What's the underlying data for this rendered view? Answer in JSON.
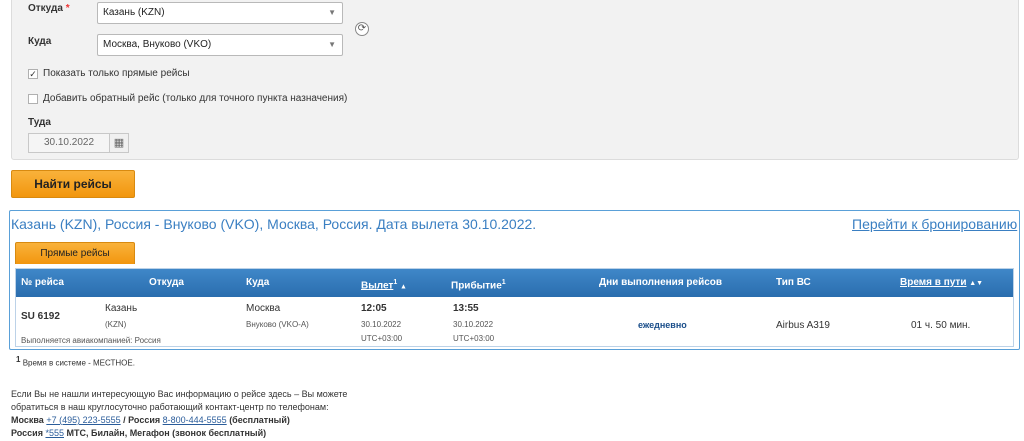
{
  "form": {
    "from_label": "Откуда",
    "required_mark": "*",
    "from_value": "Казань (KZN)",
    "to_label": "Куда",
    "to_value": "Москва, Внуково (VKO)",
    "direct_only_label": "Показать только прямые рейсы",
    "direct_only_checked": true,
    "return_label": "Добавить обратный рейс (только для точного пункта назначения)",
    "return_checked": false,
    "date_label": "Туда",
    "date_value": "30.10.2022",
    "search_button": "Найти рейсы"
  },
  "results": {
    "title": "Казань (KZN), Россия - Внуково (VKO), Москва, Россия. Дата вылета 30.10.2022.",
    "booking_link": "Перейти к бронированию",
    "tab_label": "Прямые рейсы",
    "columns": {
      "flight": "№ рейса",
      "from": "Откуда",
      "to": "Куда",
      "departure": "Вылет",
      "departure_sup": "1",
      "departure_sort": "▲",
      "arrival": "Прибытие",
      "arrival_sup": "1",
      "days": "Дни выполнения рейсов",
      "aircraft": "Тип ВС",
      "duration": "Время в пути",
      "duration_sort": "▲▼"
    },
    "row": {
      "flight": "SU 6192",
      "operated_by": "Выполняется авиакомпанией: Россия",
      "from_city": "Казань",
      "from_code": "(KZN)",
      "to_city": "Москва",
      "to_airport": "Внуково (VKO-A)",
      "dep_time": "12:05",
      "dep_date": "30.10.2022",
      "dep_tz": "UTC+03:00",
      "arr_time": "13:55",
      "arr_date": "30.10.2022",
      "arr_tz": "UTC+03:00",
      "days": "ежедневно",
      "aircraft": "Airbus A319",
      "duration": "01 ч. 50 мин."
    }
  },
  "footnote": {
    "mark": "1",
    "text": "Время в системе - МЕСТНОЕ."
  },
  "info": {
    "line1": "Если Вы не нашли интересующую Вас информацию о рейсе здесь – Вы можете",
    "line2": "обратиться в наш круглосуточно работающий контакт-центр по телефонам:",
    "moscow_label": "Москва",
    "moscow_phone": "+7 (495) 223-5555",
    "sep": " / ",
    "russia_label": "Россия",
    "russia_phone": "8-800-444-5555",
    "free_note": " (бесплатный)",
    "mobile_label": "Россия",
    "mobile_phone": "*555",
    "mobile_note": " МТС, Билайн, Мегафон (звонок бесплатный)"
  },
  "icons": {
    "swap": "swap-icon",
    "calendar": "calendar-icon",
    "caret": "caret-down-icon"
  }
}
